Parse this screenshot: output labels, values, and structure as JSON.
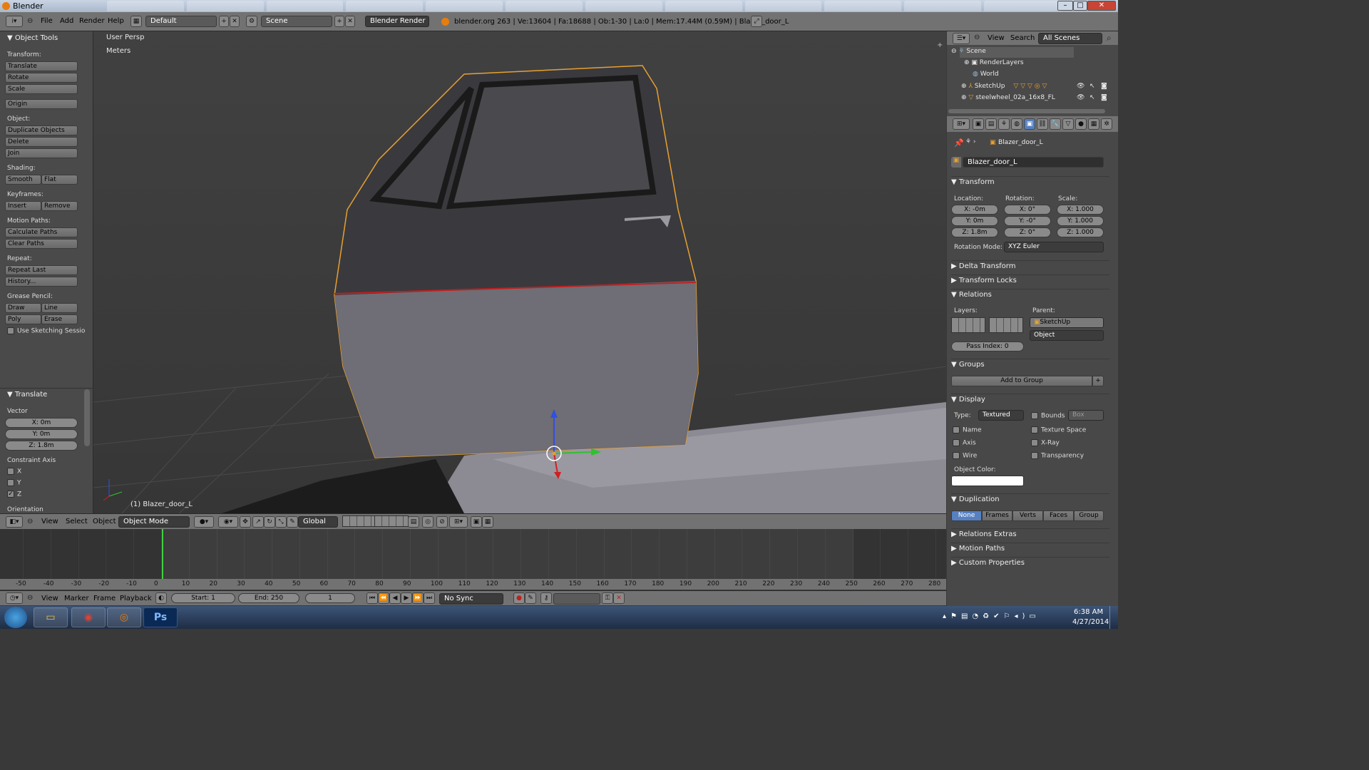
{
  "window": {
    "title": "Blender"
  },
  "info_header": {
    "menus": [
      "File",
      "Add",
      "Render",
      "Help"
    ],
    "screen_layout": "Default",
    "scene": "Scene",
    "render_engine": "Blender Render",
    "stats": "blender.org 263 | Ve:13604 | Fa:18688 | Ob:1-30 | La:0 | Mem:17.44M (0.59M) | Blazer_door_L"
  },
  "tool_shelf": {
    "header": "Object Tools",
    "transform_label": "Transform:",
    "translate": "Translate",
    "rotate": "Rotate",
    "scale": "Scale",
    "origin": "Origin",
    "object_label": "Object:",
    "duplicate": "Duplicate Objects",
    "delete": "Delete",
    "join": "Join",
    "shading_label": "Shading:",
    "smooth": "Smooth",
    "flat": "Flat",
    "keyframes_label": "Keyframes:",
    "insert": "Insert",
    "remove": "Remove",
    "motion_label": "Motion Paths:",
    "calc_paths": "Calculate Paths",
    "clear_paths": "Clear Paths",
    "repeat_label": "Repeat:",
    "repeat_last": "Repeat Last",
    "history": "History...",
    "grease_label": "Grease Pencil:",
    "draw": "Draw",
    "line": "Line",
    "poly": "Poly",
    "erase": "Erase",
    "sketching": "Use Sketching Sessio"
  },
  "operator_panel": {
    "header": "Translate",
    "vector_label": "Vector",
    "x": "X: 0m",
    "y": "Y: 0m",
    "z": "Z: 1.8m",
    "constraint_label": "Constraint Axis",
    "axes": [
      {
        "label": "X",
        "checked": false
      },
      {
        "label": "Y",
        "checked": false
      },
      {
        "label": "Z",
        "checked": true
      }
    ],
    "orientation_label": "Orientation"
  },
  "viewport": {
    "view_name": "User Persp",
    "units": "Meters",
    "object_label": "(1) Blazer_door_L"
  },
  "viewport_header": {
    "menus": [
      "View",
      "Select",
      "Object"
    ],
    "mode": "Object Mode",
    "orientation": "Global"
  },
  "timeline": {
    "ticks": [
      "-50",
      "-40",
      "-30",
      "-20",
      "-10",
      "0",
      "10",
      "20",
      "30",
      "40",
      "50",
      "60",
      "70",
      "80",
      "90",
      "100",
      "110",
      "120",
      "130",
      "140",
      "150",
      "160",
      "170",
      "180",
      "190",
      "200",
      "210",
      "220",
      "230",
      "240",
      "250",
      "260",
      "270",
      "280"
    ],
    "current_frame_value": 1,
    "menus": [
      "View",
      "Marker",
      "Frame",
      "Playback"
    ],
    "start": "Start: 1",
    "end": "End: 250",
    "frame": "1",
    "sync": "No Sync"
  },
  "outliner": {
    "menus": [
      "View",
      "Search"
    ],
    "filter": "All Scenes",
    "items": [
      "Scene",
      "RenderLayers",
      "World",
      "SketchUp",
      "steelwheel_02a_16x8_FL"
    ]
  },
  "properties": {
    "breadcrumb": "Blazer_door_L",
    "object_name": "Blazer_door_L",
    "transform": {
      "title": "Transform",
      "location_label": "Location:",
      "rotation_label": "Rotation:",
      "scale_label": "Scale:",
      "location": [
        "X: -0m",
        "Y: 0m",
        "Z: 1.8m"
      ],
      "rotation": [
        "X: 0°",
        "Y: -0°",
        "Z: 0°"
      ],
      "scale": [
        "X: 1.000",
        "Y: 1.000",
        "Z: 1.000"
      ],
      "rotation_mode_label": "Rotation Mode:",
      "rotation_mode": "XYZ Euler"
    },
    "delta_transform": "Delta Transform",
    "transform_locks": "Transform Locks",
    "relations": {
      "title": "Relations",
      "layers_label": "Layers:",
      "parent_label": "Parent:",
      "parent": "SketchUp",
      "parent_type": "Object",
      "pass_index": "Pass Index: 0"
    },
    "groups": {
      "title": "Groups",
      "add": "Add to Group"
    },
    "display": {
      "title": "Display",
      "type_label": "Type:",
      "type": "Textured",
      "bounds": "Bounds",
      "bounds_type": "Box",
      "name": "Name",
      "texture_space": "Texture Space",
      "axis": "Axis",
      "xray": "X-Ray",
      "wire": "Wire",
      "transparency": "Transparency",
      "object_color_label": "Object Color:"
    },
    "duplication": {
      "title": "Duplication",
      "options": [
        "None",
        "Frames",
        "Verts",
        "Faces",
        "Group"
      ],
      "active": "None"
    },
    "relations_extras": "Relations Extras",
    "motion_paths": "Motion Paths",
    "custom_properties": "Custom Properties"
  },
  "taskbar": {
    "time": "6:38 AM",
    "date": "4/27/2014",
    "apps": [
      "Explorer",
      "Chrome",
      "Blender",
      "Ps"
    ]
  },
  "colors": {
    "selection_outline": "#e8a030",
    "active_blue": "#5680c2",
    "playhead": "#40d040"
  }
}
